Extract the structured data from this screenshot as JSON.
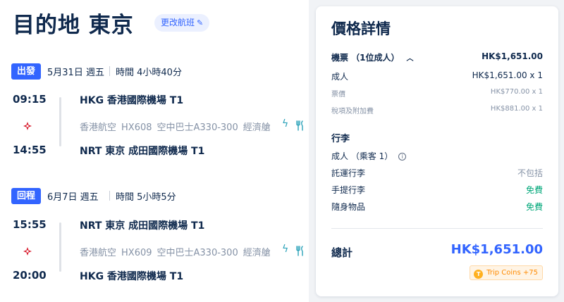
{
  "header": {
    "title": "目的地 東京",
    "change_label": "更改航班"
  },
  "outbound": {
    "badge": "出發",
    "date": "5月31日 週五",
    "duration": "時間 4小時40分",
    "depart_time": "09:15",
    "arrive_time": "14:55",
    "depart_airport": "HKG 香港國際機場 T1",
    "arrive_airport": "NRT 東京 成田國際機場 T1",
    "airline": "香港航空",
    "flight_no": "HX608",
    "aircraft": "空中巴士A330-300",
    "cabin": "經濟艙"
  },
  "return": {
    "badge": "回程",
    "date": "6月7日 週五",
    "duration": "時間 5小時5分",
    "depart_time": "15:55",
    "arrive_time": "20:00",
    "depart_airport": "NRT 東京 成田國際機場 T1",
    "arrive_airport": "HKG 香港國際機場 T1",
    "airline": "香港航空",
    "flight_no": "HX609",
    "aircraft": "空中巴士A330-300",
    "cabin": "經濟艙"
  },
  "price": {
    "title": "價格詳情",
    "ticket_label": "機票 （1位成人）",
    "ticket_total": "HK$1,651.00",
    "adult_label": "成人",
    "adult_value": "HK$1,651.00 x 1",
    "fare_label": "票價",
    "fare_value": "HK$770.00 x 1",
    "tax_label": "稅項及附加費",
    "tax_value": "HK$881.00 x 1",
    "baggage_title": "行李",
    "baggage_passenger": "成人 （乘客 1）",
    "checked_label": "託運行李",
    "checked_value": "不包括",
    "carryon_label": "手提行李",
    "carryon_value": "免費",
    "personal_label": "隨身物品",
    "personal_value": "免費",
    "total_label": "總計",
    "total_value": "HK$1,651.00",
    "coins_label": "Trip Coins +75"
  },
  "colors": {
    "primary": "#3264ff",
    "text": "#0f294d",
    "muted": "#8592a6",
    "free": "#00a779",
    "amenity": "#2ba2b9",
    "airline_red": "#d7182a"
  },
  "icons": {
    "edit": "pencil-icon",
    "airline": "airline-logo-icon",
    "power": "bolt-icon",
    "meal": "utensils-icon",
    "collapse": "chevron-up-icon",
    "info": "info-icon",
    "coin": "trip-coin-icon"
  }
}
